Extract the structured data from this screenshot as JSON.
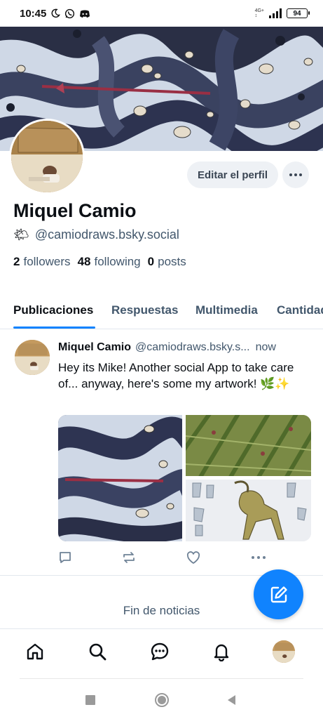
{
  "status_bar": {
    "time": "10:45",
    "network": "4G+",
    "battery": "94"
  },
  "profile": {
    "display_name": "Miquel Camio",
    "handle_emoji": "🌤",
    "handle": "@camiodraws.bsky.social",
    "edit_label": "Editar el perfil",
    "stats": {
      "followers_count": "2",
      "followers_label": "followers",
      "following_count": "48",
      "following_label": "following",
      "posts_count": "0",
      "posts_label": "posts"
    }
  },
  "tabs": [
    {
      "label": "Publicaciones",
      "active": true
    },
    {
      "label": "Respuestas",
      "active": false
    },
    {
      "label": "Multimedia",
      "active": false
    },
    {
      "label": "Cantidad",
      "active": false
    }
  ],
  "post": {
    "author": "Miquel Camio",
    "handle": "@camiodraws.bsky.s...",
    "time": "now",
    "text": "Hey its Mike! Another social App to take care of... anyway, here's some my artwork! 🌿✨"
  },
  "feed_end": "Fin de noticias",
  "colors": {
    "accent": "#1083fe",
    "muted_text": "#42576c",
    "chip_bg": "#eef1f5"
  },
  "icons": {
    "nav": [
      "home-icon",
      "search-icon",
      "chat-icon",
      "bell-icon",
      "avatar"
    ],
    "post_actions": [
      "reply-icon",
      "repost-icon",
      "like-icon",
      "more-icon"
    ],
    "fab": "compose-icon"
  }
}
